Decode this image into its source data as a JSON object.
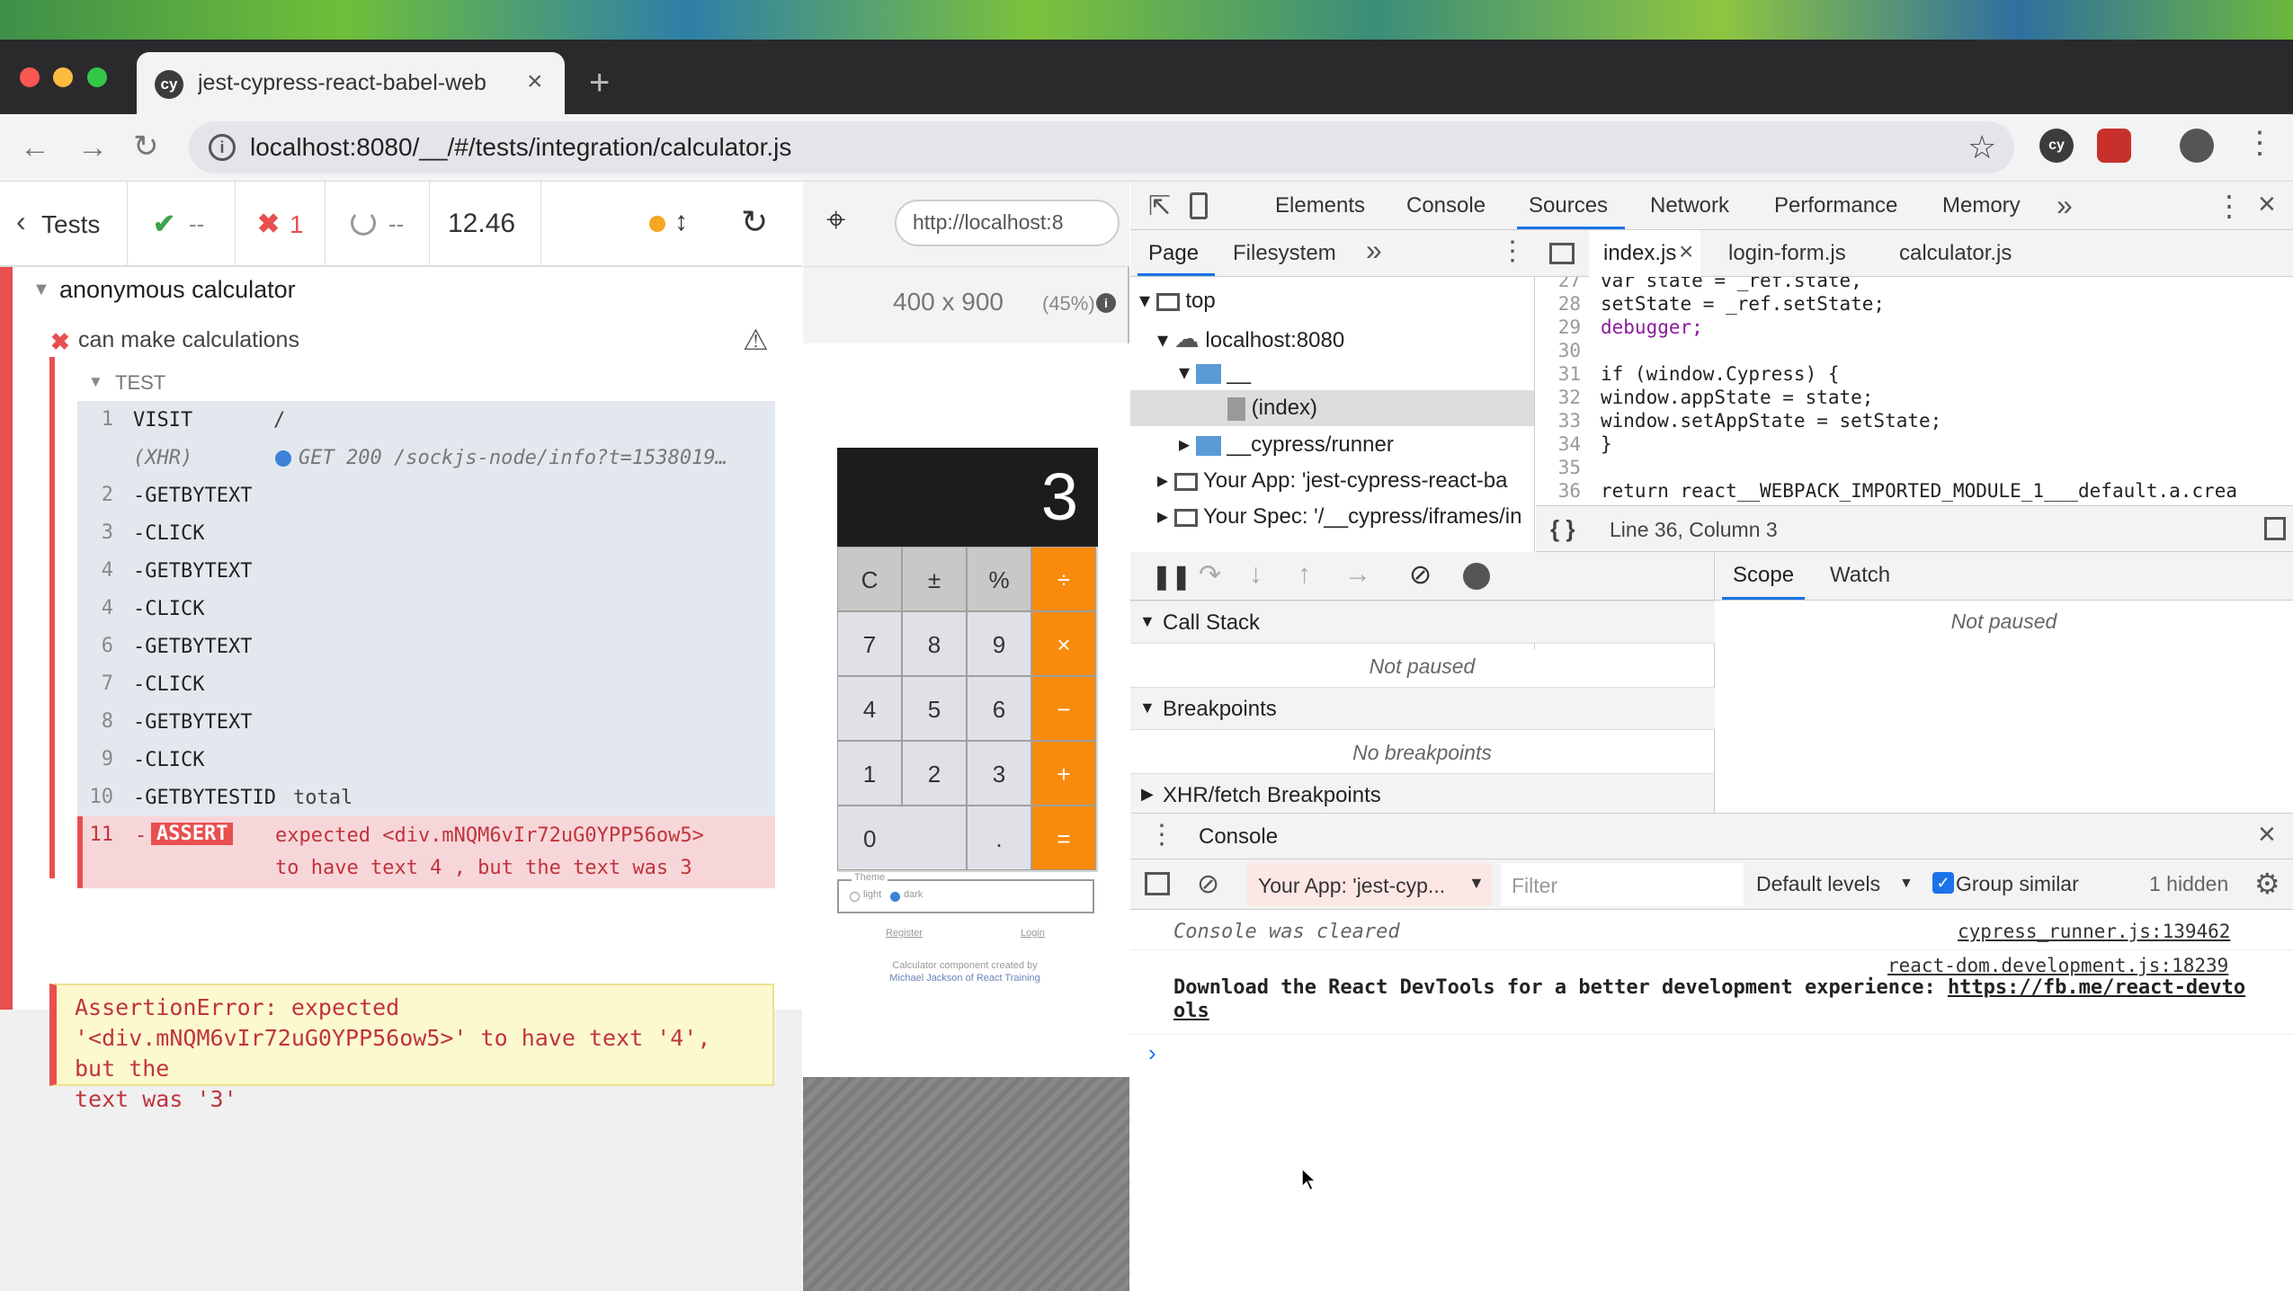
{
  "browser": {
    "tab_title": "jest-cypress-react-babel-web",
    "url": "localhost:8080/__/#/tests/integration/calculator.js",
    "favicon_text": "cy"
  },
  "reporter": {
    "tests_label": "Tests",
    "passed": "--",
    "failed": "1",
    "pending": "--",
    "duration": "12.46",
    "suite_title": "anonymous calculator",
    "test_title": "can make calculations",
    "test_header": "TEST",
    "commands": [
      {
        "num": "1",
        "name": "VISIT",
        "msg": "/"
      },
      {
        "num": "",
        "name": "(XHR)",
        "msg": "GET 200 /sockjs-node/info?t=1538019…"
      },
      {
        "num": "2",
        "name": "-GETBYTEXT",
        "msg": ""
      },
      {
        "num": "3",
        "name": "-CLICK",
        "msg": ""
      },
      {
        "num": "4",
        "name": "-GETBYTEXT",
        "msg": ""
      },
      {
        "num": "4",
        "name": "-CLICK",
        "msg": ""
      },
      {
        "num": "6",
        "name": "-GETBYTEXT",
        "msg": ""
      },
      {
        "num": "7",
        "name": "-CLICK",
        "msg": ""
      },
      {
        "num": "8",
        "name": "-GETBYTEXT",
        "msg": ""
      },
      {
        "num": "9",
        "name": "-CLICK",
        "msg": ""
      },
      {
        "num": "10",
        "name": "-GETBYTESTID",
        "msg": "total"
      }
    ],
    "assert": {
      "num": "11",
      "name": "ASSERT",
      "line1": "expected <div.mNQM6vIr72uG0YPP56ow5>",
      "line2": "to have text 4 , but the text was 3"
    },
    "error": {
      "line1": "AssertionError: expected",
      "line2": "'<div.mNQM6vIr72uG0YPP56ow5>' to have text '4', but the",
      "line3": "text was '3'"
    }
  },
  "aut": {
    "url": "http://localhost:8",
    "viewport": "400 x 900",
    "scale": "(45%)",
    "display": "3",
    "keys": {
      "row1": [
        "C",
        "±",
        "%",
        "÷"
      ],
      "row2": [
        "7",
        "8",
        "9",
        "×"
      ],
      "row3": [
        "4",
        "5",
        "6",
        "−"
      ],
      "row4": [
        "1",
        "2",
        "3",
        "+"
      ],
      "row5": [
        "0",
        ".",
        "="
      ]
    },
    "theme_label": "Theme",
    "theme_light": "light",
    "theme_dark": "dark",
    "register": "Register",
    "login": "Login",
    "credit_line1": "Calculator component created by",
    "credit_line2": "Michael Jackson of React Training"
  },
  "devtools": {
    "tabs": [
      "Elements",
      "Console",
      "Sources",
      "Network",
      "Performance",
      "Memory"
    ],
    "active_tab": "Sources",
    "nav_tabs": [
      "Page",
      "Filesystem"
    ],
    "tree": {
      "top": "top",
      "host": "localhost:8080",
      "folder": "__",
      "index": "(index)",
      "runner": "__cypress/runner",
      "app": "Your App: 'jest-cypress-react-ba",
      "spec": "Your Spec: '/__cypress/iframes/in"
    },
    "files": [
      "index.js",
      "login-form.js",
      "calculator.js"
    ],
    "code": [
      {
        "ln": "27",
        "src": "var state = _ref.state,"
      },
      {
        "ln": "28",
        "src": "    setState = _ref.setState;"
      },
      {
        "ln": "29",
        "src": "debugger;"
      },
      {
        "ln": "30",
        "src": ""
      },
      {
        "ln": "31",
        "src": "if (window.Cypress) {"
      },
      {
        "ln": "32",
        "src": "  window.appState = state;"
      },
      {
        "ln": "33",
        "src": "  window.setAppState = setState;"
      },
      {
        "ln": "34",
        "src": "}"
      },
      {
        "ln": "35",
        "src": ""
      },
      {
        "ln": "36",
        "src": "return react__WEBPACK_IMPORTED_MODULE_1___default.a.crea"
      }
    ],
    "cursor": "Line 36, Column 3",
    "call_stack": "Call Stack",
    "not_paused": "Not paused",
    "breakpoints": "Breakpoints",
    "no_breakpoints": "No breakpoints",
    "xhr_breakpoints": "XHR/fetch Breakpoints",
    "scope_tab": "Scope",
    "watch_tab": "Watch",
    "scope_msg": "Not paused",
    "drawer_title": "Console",
    "context": "Your App: 'jest-cyp...",
    "filter_placeholder": "Filter",
    "levels": "Default levels",
    "group_similar": "Group similar",
    "hidden": "1 hidden",
    "messages": {
      "cleared": "Console was cleared",
      "cleared_src": "cypress_runner.js:139462",
      "react_src": "react-dom.development.js:18239",
      "react_text": "Download the React DevTools for a better development experience: ",
      "react_link1": "https://fb.me/react-devto",
      "react_link2": "ols"
    }
  },
  "colors": {
    "fail": "#e94f4f",
    "pass": "#3aa648",
    "calc_op": "#f88b0b",
    "devtools_accent": "#1a73e8"
  }
}
